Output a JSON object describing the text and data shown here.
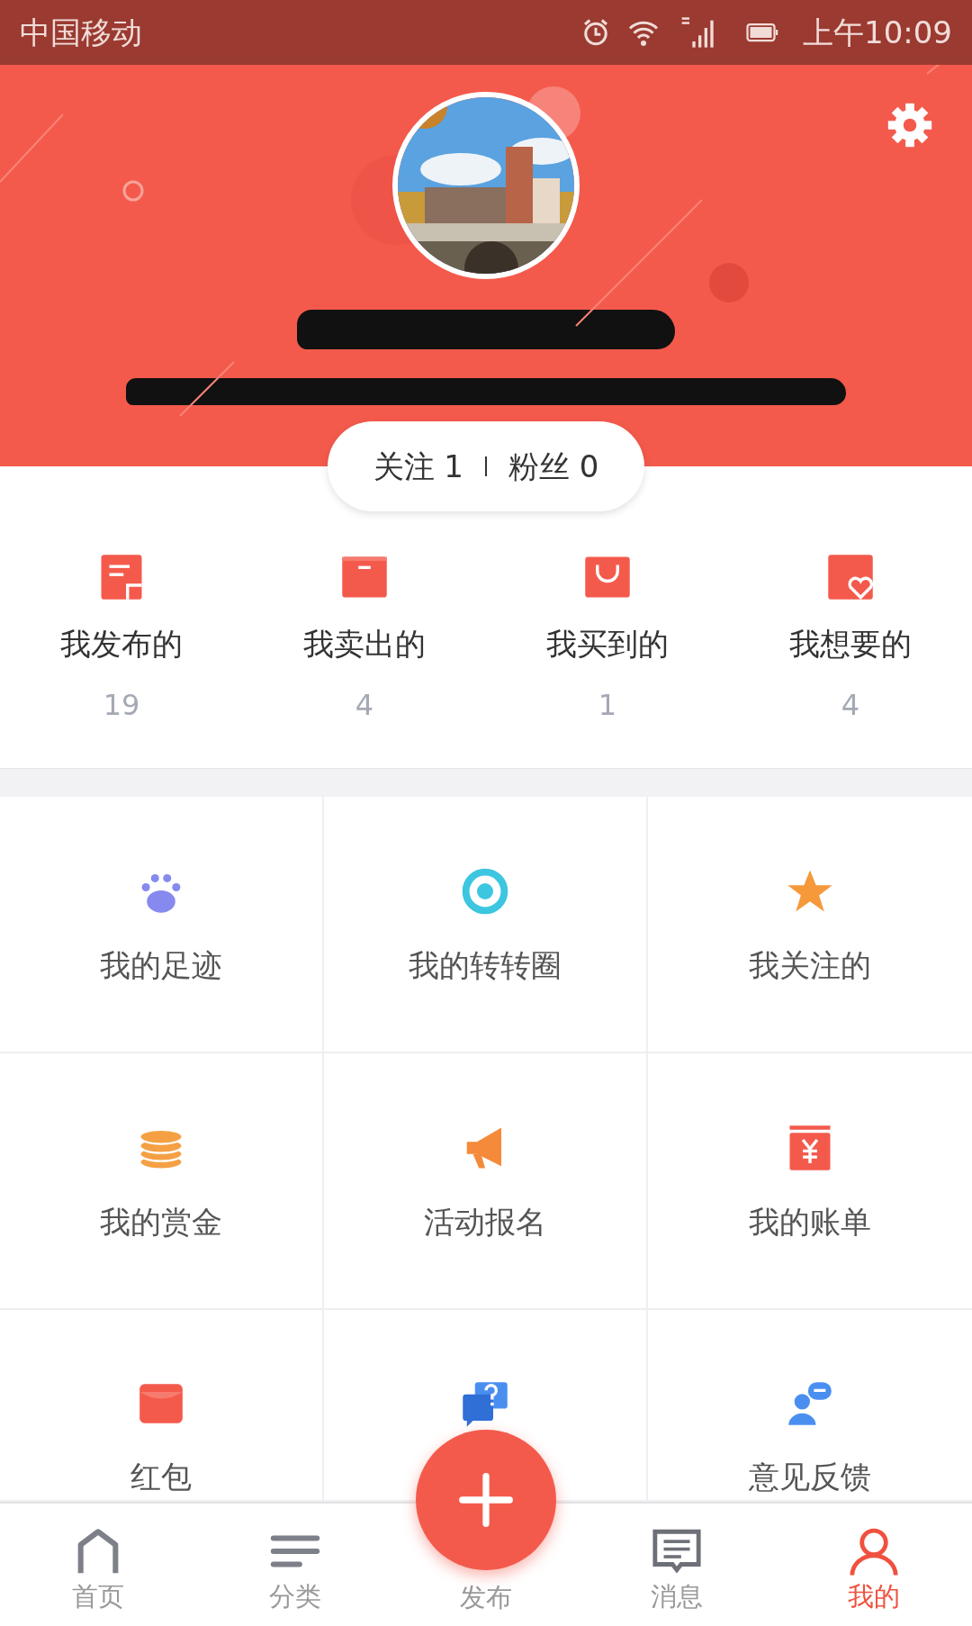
{
  "status_bar": {
    "carrier": "中国移动",
    "time": "上午10:09"
  },
  "profile": {
    "follow_label": "关注",
    "follow_count": "1",
    "fans_label": "粉丝",
    "fans_count": "0"
  },
  "stats": [
    {
      "label": "我发布的",
      "count": "19"
    },
    {
      "label": "我卖出的",
      "count": "4"
    },
    {
      "label": "我买到的",
      "count": "1"
    },
    {
      "label": "我想要的",
      "count": "4"
    }
  ],
  "grid": [
    {
      "kind": "tile",
      "label": "我的足迹"
    },
    {
      "kind": "tile",
      "label": "我的转转圈"
    },
    {
      "kind": "tile",
      "label": "我关注的"
    },
    {
      "kind": "tile",
      "label": "我的赏金"
    },
    {
      "kind": "tile",
      "label": "活动报名"
    },
    {
      "kind": "tile",
      "label": "我的账单"
    },
    {
      "kind": "tile",
      "label": "红包"
    },
    {
      "kind": "covered"
    },
    {
      "kind": "tile",
      "label": "意见反馈"
    }
  ],
  "tab_bar": [
    {
      "label": "首页",
      "selected": false
    },
    {
      "label": "分类",
      "selected": false
    },
    {
      "label": "发布",
      "kind": "publish",
      "selected": false
    },
    {
      "label": "消息",
      "selected": false
    },
    {
      "label": "我的",
      "selected": true
    }
  ]
}
